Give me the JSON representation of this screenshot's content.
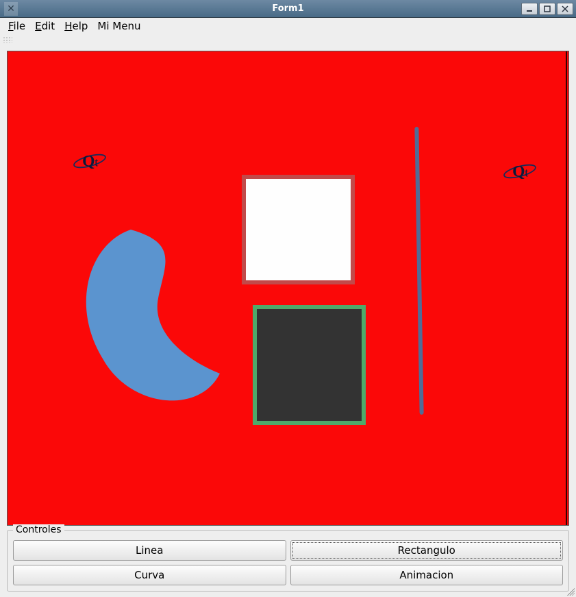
{
  "window": {
    "title": "Form1"
  },
  "menu": {
    "file": "File",
    "edit": "Edit",
    "help": "Help",
    "mimenu": "Mi Menu"
  },
  "canvas": {
    "background": "#fb0808",
    "shapes": {
      "white_rect": {
        "border": "#c24a4a",
        "fill": "#fefefe"
      },
      "dark_rect": {
        "border": "#4eaa6a",
        "fill": "#333333"
      },
      "vertical_line": {
        "color": "#506c97"
      },
      "blob": {
        "fill": "#5b94cf"
      }
    },
    "logos": [
      "Qt",
      "Qt"
    ]
  },
  "controls": {
    "legend": "Controles",
    "linea": "Linea",
    "rectangulo": "Rectangulo",
    "curva": "Curva",
    "animacion": "Animacion"
  }
}
